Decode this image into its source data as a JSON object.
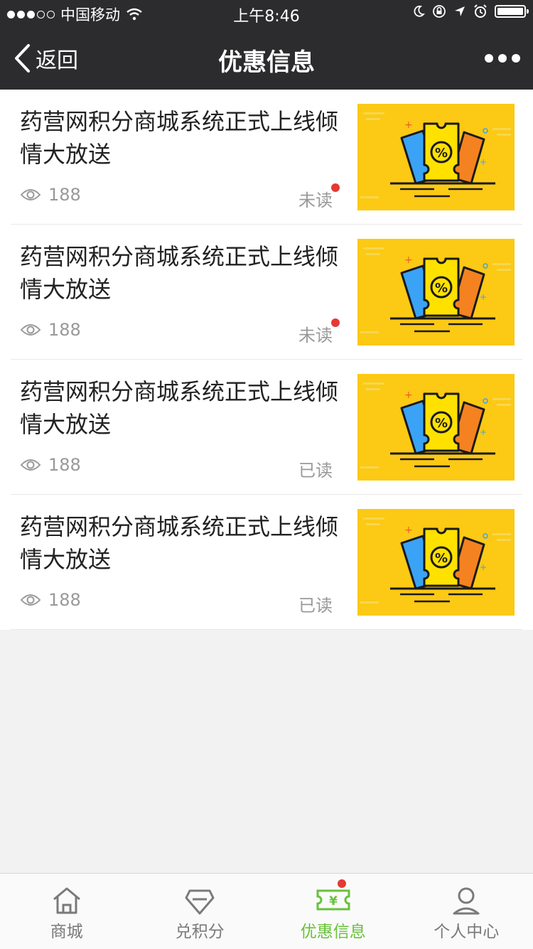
{
  "status_bar": {
    "carrier": "中国移动",
    "time": "上午8:46"
  },
  "nav": {
    "back_label": "返回",
    "title": "优惠信息"
  },
  "items": [
    {
      "title": "药营网积分商城系统正式上线倾情大放送",
      "views": "188",
      "status": "未读",
      "unread": true
    },
    {
      "title": "药营网积分商城系统正式上线倾情大放送",
      "views": "188",
      "status": "未读",
      "unread": true
    },
    {
      "title": "药营网积分商城系统正式上线倾情大放送",
      "views": "188",
      "status": "已读",
      "unread": false
    },
    {
      "title": "药营网积分商城系统正式上线倾情大放送",
      "views": "188",
      "status": "已读",
      "unread": false
    }
  ],
  "tabs": [
    {
      "label": "商城",
      "icon": "home-icon"
    },
    {
      "label": "兑积分",
      "icon": "diamond-icon"
    },
    {
      "label": "优惠信息",
      "icon": "coupon-icon",
      "active": true,
      "badge": true
    },
    {
      "label": "个人中心",
      "icon": "user-icon"
    }
  ],
  "colors": {
    "accent": "#67c23a",
    "badge": "#e53935",
    "nav_bg": "#2c2c2e",
    "thumb_bg": "#fcc914"
  }
}
